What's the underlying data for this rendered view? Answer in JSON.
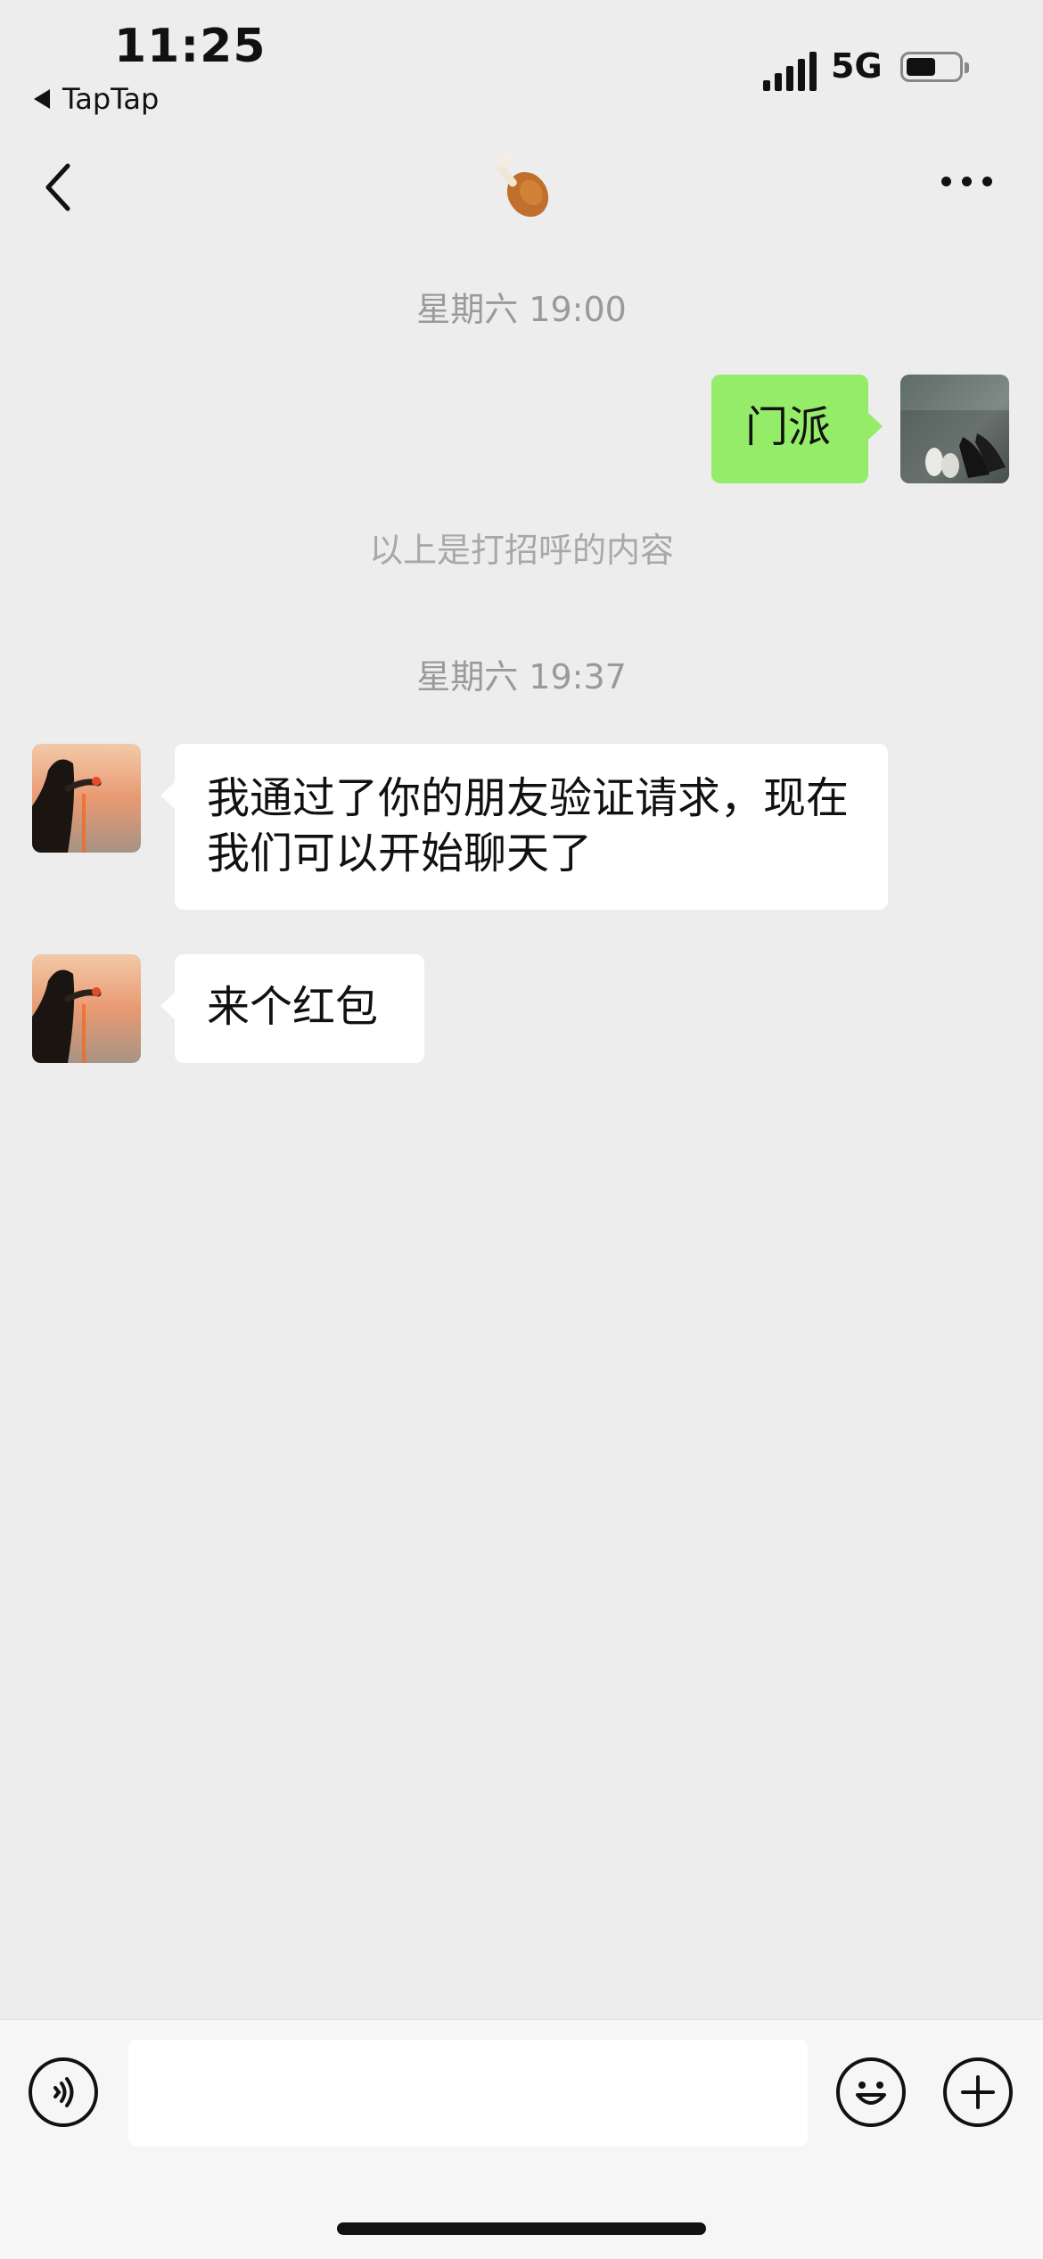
{
  "status_bar": {
    "time": "11:25",
    "back_app": "TapTap",
    "network": "5G",
    "battery_level": 0.55
  },
  "nav": {
    "title_icon": "chicken-leg-emoji",
    "back_icon": "chevron-left-icon",
    "more_icon": "more-dots-icon"
  },
  "messages": [
    {
      "type": "timestamp",
      "text": "星期六 19:00"
    },
    {
      "type": "outgoing",
      "text": "门派"
    },
    {
      "type": "system",
      "text": "以上是打招呼的内容"
    },
    {
      "type": "timestamp",
      "text": "星期六 19:37"
    },
    {
      "type": "incoming",
      "text": "我通过了你的朋友验证请求，现在我们可以开始聊天了"
    },
    {
      "type": "incoming",
      "text": "来个红包"
    }
  ],
  "input_bar": {
    "voice_icon": "voice-icon",
    "emoji_icon": "emoji-icon",
    "plus_icon": "plus-icon",
    "value": ""
  },
  "colors": {
    "background": "#ededed",
    "outgoing_bubble": "#95ec69",
    "incoming_bubble": "#ffffff"
  }
}
